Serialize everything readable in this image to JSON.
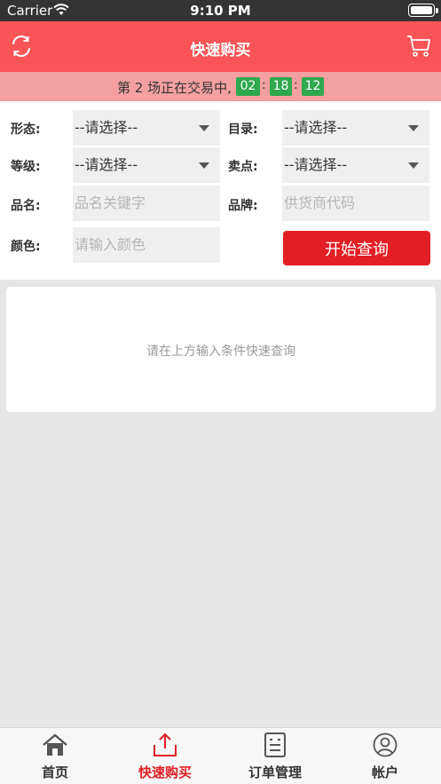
{
  "status_bar": {
    "carrier": "Carrier",
    "time": "9:10 PM"
  },
  "nav": {
    "title": "快速购买",
    "left_icon": "refresh-icon",
    "right_icon": "cart-icon"
  },
  "session": {
    "text": "第 2 场正在交易中,",
    "hours": "02",
    "minutes": "18",
    "seconds": "12",
    "separator": ":",
    "timer_color": "#2fa84f"
  },
  "form": {
    "shape_label": "形态:",
    "shape_value": "--请选择--",
    "catalog_label": "目录:",
    "catalog_value": "--请选择--",
    "grade_label": "等级:",
    "grade_value": "--请选择--",
    "selling_point_label": "卖点:",
    "selling_point_value": "--请选择--",
    "name_label": "品名:",
    "name_placeholder": "品名关键字",
    "brand_label": "品牌:",
    "brand_placeholder": "供货商代码",
    "color_label": "颜色:",
    "color_placeholder": "请输入颜色",
    "query_button": "开始查询"
  },
  "result": {
    "hint": "请在上方输入条件快速查询"
  },
  "tabs": [
    {
      "label": "首页",
      "icon": "home-icon",
      "active": false
    },
    {
      "label": "快速购买",
      "icon": "upload-icon",
      "active": true
    },
    {
      "label": "订单管理",
      "icon": "order-icon",
      "active": false
    },
    {
      "label": "帐户",
      "icon": "account-icon",
      "active": false
    }
  ],
  "colors": {
    "brand": "#f95556",
    "accent": "#e11f24",
    "session_bg": "#f4a0a0"
  }
}
